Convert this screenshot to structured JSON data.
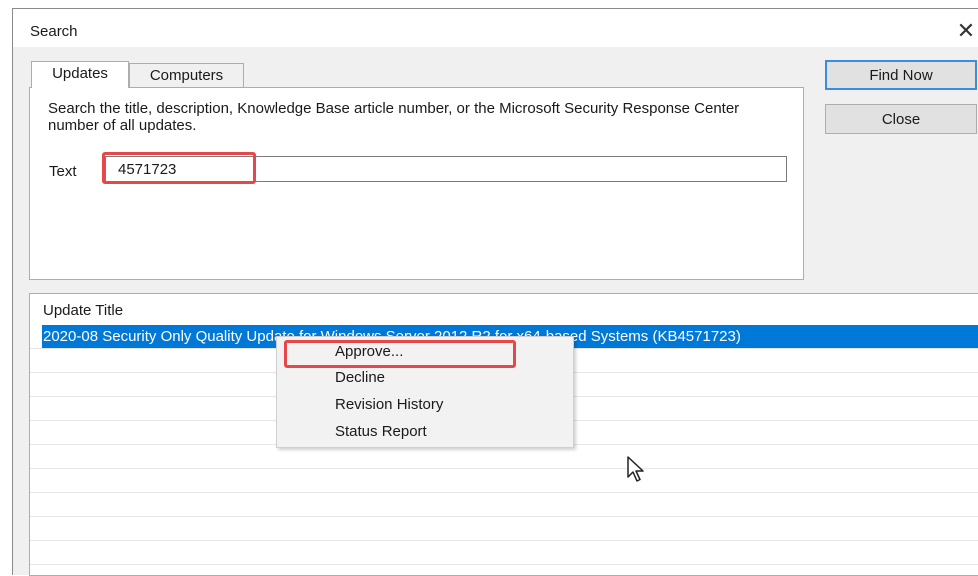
{
  "window": {
    "title": "Search",
    "close_glyph": "✕"
  },
  "tabs": [
    {
      "label": "Updates",
      "active": true
    },
    {
      "label": "Computers",
      "active": false
    }
  ],
  "search": {
    "description": "Search the title, description, Knowledge Base article number, or the Microsoft Security Response Center number of all updates.",
    "text_label": "Text",
    "text_value": "4571723"
  },
  "buttons": {
    "find_now": "Find Now",
    "close": "Close"
  },
  "results": {
    "column_header": "Update Title",
    "rows": [
      {
        "title": "2020-08 Security Only Quality Update for Windows Server 2012 R2 for x64-based Systems (KB4571723)",
        "selected": true
      }
    ]
  },
  "context_menu": {
    "items": [
      "Approve...",
      "Decline",
      "Revision History",
      "Status Report"
    ]
  },
  "colors": {
    "selection": "#0078d7",
    "highlight_box": "#e54848",
    "default_button_border": "#3c8de0"
  },
  "icons": {
    "close": "close-icon",
    "cursor": "mouse-pointer-icon"
  }
}
